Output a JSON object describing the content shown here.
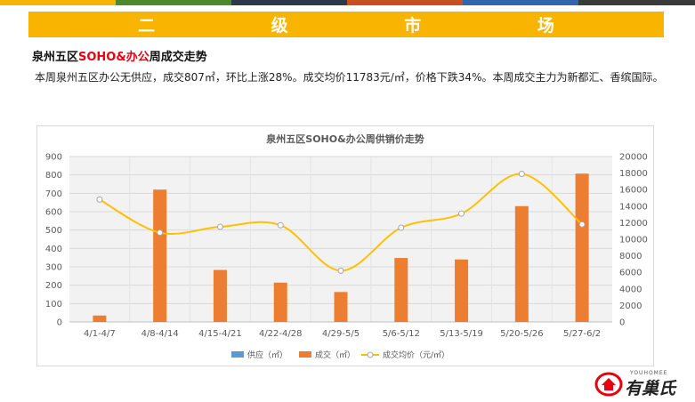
{
  "top_stripe_colors": [
    "#f8b400",
    "#4f8a2a",
    "#2e3a4a",
    "#c8501e",
    "#2e66b0",
    "#3a3a3a"
  ],
  "banner": {
    "title": "二 级 市 场",
    "color": "#f8b400"
  },
  "heading": {
    "part1": "泉州五区",
    "part2": "SOHO&办公",
    "part3": "周成交走势",
    "accent": "#e60012"
  },
  "paragraph": "本周泉州五区办公无供应，成交807㎡，环比上涨28%。成交均价11783元/㎡，价格下跌34%。本周成交主力为新都汇、香缤国际。",
  "chart_data": {
    "type": "bar",
    "title": "泉州五区SOHO&办公周供销价走势",
    "categories": [
      "4/1-4/7",
      "4/8-4/14",
      "4/15-4/21",
      "4/22-4/28",
      "4/29-5/5",
      "5/6-5/12",
      "5/13-5/19",
      "5/20-5/26",
      "5/27-6/2"
    ],
    "series": [
      {
        "name": "供应（㎡）",
        "type": "bar",
        "axis": "left",
        "color": "#5b9bd5",
        "values": [
          0,
          0,
          0,
          0,
          0,
          0,
          0,
          0,
          0
        ]
      },
      {
        "name": "成交（㎡）",
        "type": "bar",
        "axis": "left",
        "color": "#ed7d31",
        "values": [
          35,
          720,
          283,
          214,
          163,
          348,
          340,
          630,
          807
        ]
      },
      {
        "name": "成交均价（元/㎡）",
        "type": "line",
        "axis": "right",
        "color": "#ffc000",
        "values": [
          14800,
          10800,
          11500,
          11700,
          6200,
          11400,
          13100,
          17900,
          11783
        ]
      }
    ],
    "ylim_left": [
      0,
      900
    ],
    "yticks_left": [
      0,
      100,
      200,
      300,
      400,
      500,
      600,
      700,
      800,
      900
    ],
    "ylim_right": [
      0,
      20000
    ],
    "yticks_right": [
      0,
      2000,
      4000,
      6000,
      8000,
      10000,
      12000,
      14000,
      16000,
      18000,
      20000
    ],
    "grid": true,
    "legend_position": "bottom"
  },
  "logo": {
    "text": "有巢氏",
    "subtext": "YOUHOMEE"
  }
}
